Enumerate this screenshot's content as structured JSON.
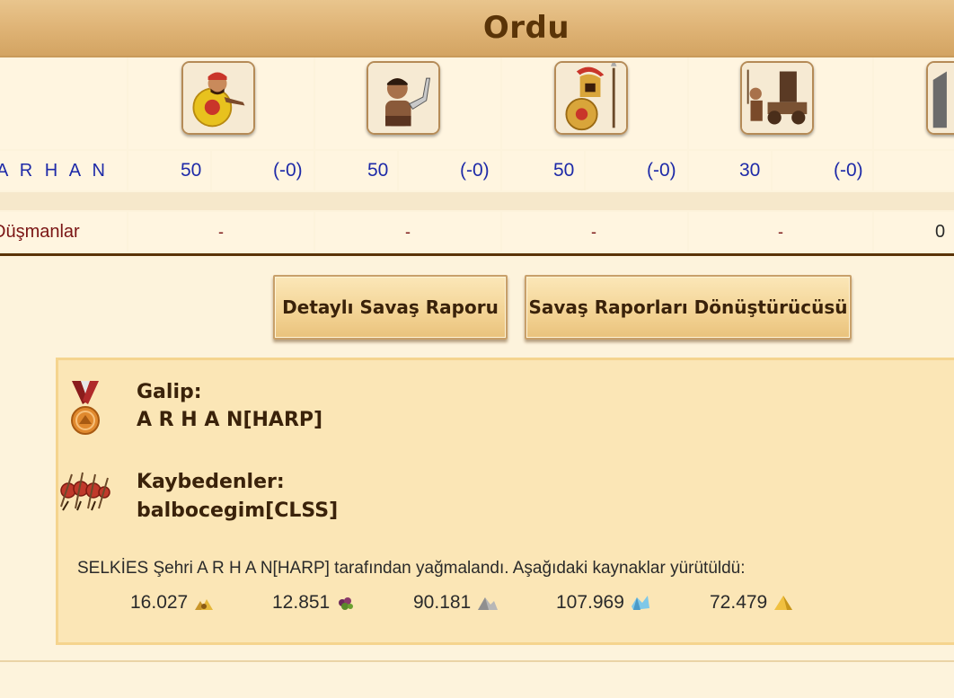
{
  "header": {
    "title": "Ordu"
  },
  "units": [
    {
      "icon": "spearman-unit-icon"
    },
    {
      "icon": "slinger-unit-icon"
    },
    {
      "icon": "hoplite-unit-icon"
    },
    {
      "icon": "catapult-unit-icon"
    },
    {
      "icon": "partial-unit-icon"
    }
  ],
  "attacker": {
    "name": "A R H A N",
    "counts": [
      {
        "value": "50",
        "loss": "(-0)"
      },
      {
        "value": "50",
        "loss": "(-0)"
      },
      {
        "value": "50",
        "loss": "(-0)"
      },
      {
        "value": "30",
        "loss": "(-0)"
      }
    ]
  },
  "enemies": {
    "label": "Düşmanlar",
    "values": [
      "-",
      "-",
      "-",
      "-",
      "0"
    ]
  },
  "buttons": {
    "detailed_report": "Detaylı Savaş Raporu",
    "report_converter": "Savaş Raporları Dönüştürücüsü"
  },
  "result": {
    "winner_title": "Galip:",
    "winner_name": "A R H A N[HARP]",
    "losers_title": "Kaybedenler:",
    "losers_name": "balbocegim[CLSS]",
    "summary": "SELKİES Şehri A R H A N[HARP] tarafından yağmalandı. Aşağıdaki kaynaklar yürütüldü:",
    "resources": [
      {
        "value": "16.027",
        "icon": "gold-resource-icon"
      },
      {
        "value": "12.851",
        "icon": "wine-resource-icon"
      },
      {
        "value": "90.181",
        "icon": "marble-resource-icon"
      },
      {
        "value": "107.969",
        "icon": "crystal-resource-icon"
      },
      {
        "value": "72.479",
        "icon": "sulfur-resource-icon"
      }
    ]
  },
  "colors": {
    "header_bg": "#deb274",
    "title_brown": "#5a3408",
    "count_blue": "#1e2aa8",
    "enemy_red": "#7a1414",
    "panel_bg": "#fbe6b6"
  }
}
